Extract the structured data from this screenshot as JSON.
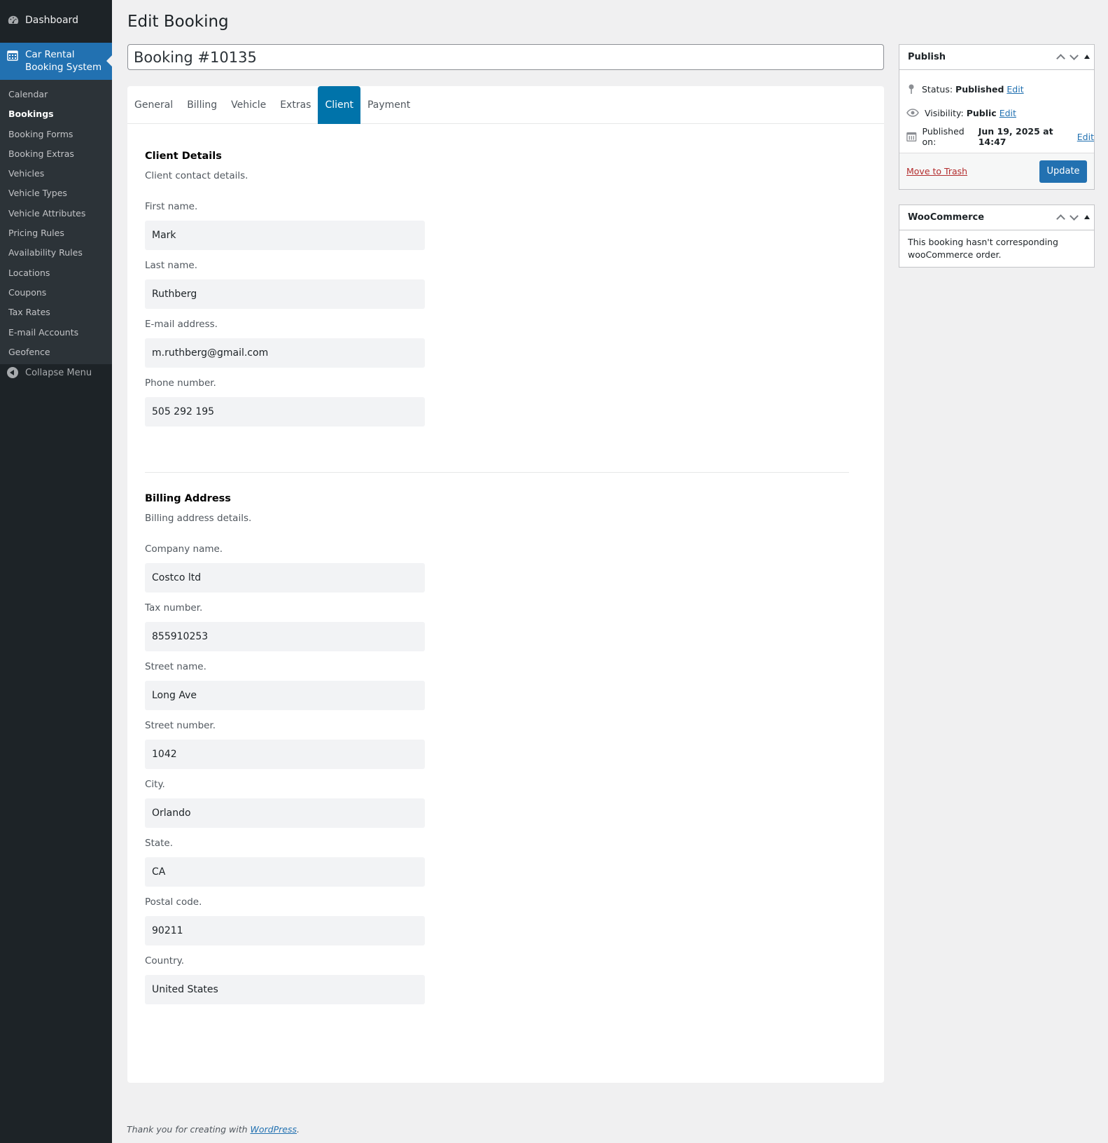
{
  "sidebar": {
    "dashboard": "Dashboard",
    "active_menu_line1": "Car Rental",
    "active_menu_line2": "Booking System",
    "submenu": [
      "Calendar",
      "Bookings",
      "Booking Forms",
      "Booking Extras",
      "Vehicles",
      "Vehicle Types",
      "Vehicle Attributes",
      "Pricing Rules",
      "Availability Rules",
      "Locations",
      "Coupons",
      "Tax Rates",
      "E-mail Accounts",
      "Geofence"
    ],
    "collapse": "Collapse Menu"
  },
  "page": {
    "title": "Edit Booking",
    "booking_title": "Booking #10135"
  },
  "tabs": [
    "General",
    "Billing",
    "Vehicle",
    "Extras",
    "Client",
    "Payment"
  ],
  "client": {
    "title": "Client Details",
    "description": "Client contact details.",
    "fields": [
      {
        "label": "First name.",
        "value": "Mark"
      },
      {
        "label": "Last name.",
        "value": "Ruthberg"
      },
      {
        "label": "E-mail address.",
        "value": "m.ruthberg@gmail.com"
      },
      {
        "label": "Phone number.",
        "value": "505 292 195"
      }
    ]
  },
  "billing": {
    "title": "Billing Address",
    "description": "Billing address details.",
    "fields": [
      {
        "label": "Company name.",
        "value": "Costco ltd"
      },
      {
        "label": "Tax number.",
        "value": "855910253"
      },
      {
        "label": "Street name.",
        "value": "Long Ave"
      },
      {
        "label": "Street number.",
        "value": "1042"
      },
      {
        "label": "City.",
        "value": "Orlando"
      },
      {
        "label": "State.",
        "value": "CA"
      },
      {
        "label": "Postal code.",
        "value": "90211"
      },
      {
        "label": "Country.",
        "value": "United States"
      }
    ]
  },
  "publish": {
    "title": "Publish",
    "status_label": "Status:",
    "status_value": "Published",
    "visibility_label": "Visibility:",
    "visibility_value": "Public",
    "published_label": "Published on:",
    "published_value": "Jun 19, 2025 at 14:47",
    "edit": "Edit",
    "trash": "Move to Trash",
    "update": "Update"
  },
  "woocommerce": {
    "title": "WooCommerce",
    "message": "This booking hasn't corresponding wooCommerce order."
  },
  "footer": {
    "text": "Thank you for creating with ",
    "link": "WordPress",
    "end": "."
  }
}
